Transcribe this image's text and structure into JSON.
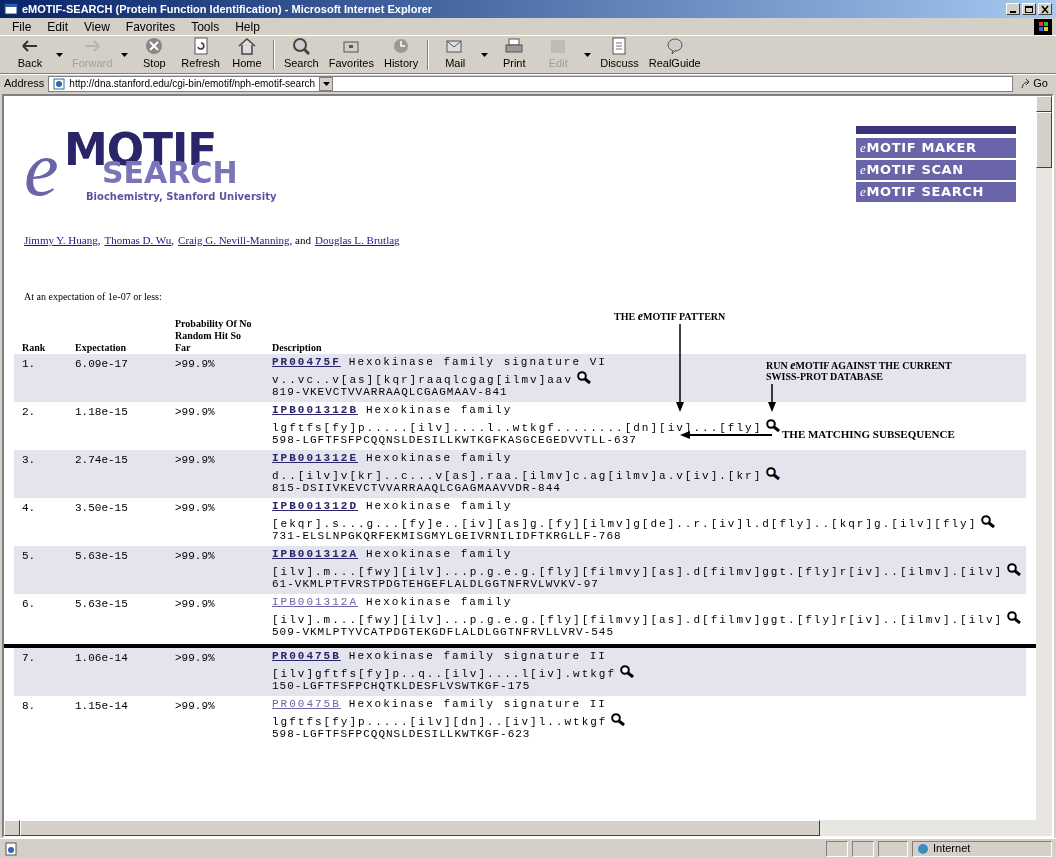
{
  "window": {
    "title": "eMOTIF-SEARCH (Protein Function Identification) - Microsoft Internet Explorer"
  },
  "menu": [
    "File",
    "Edit",
    "View",
    "Favorites",
    "Tools",
    "Help"
  ],
  "toolbar": [
    {
      "label": "Back",
      "kind": "back",
      "disabled": false,
      "dropdown": true
    },
    {
      "label": "Forward",
      "kind": "forward",
      "disabled": true,
      "dropdown": true
    },
    {
      "label": "Stop",
      "kind": "stop",
      "disabled": false,
      "dropdown": false
    },
    {
      "label": "Refresh",
      "kind": "refresh",
      "disabled": false,
      "dropdown": false
    },
    {
      "label": "Home",
      "kind": "home",
      "disabled": false,
      "dropdown": false
    },
    {
      "label": "Search",
      "kind": "search",
      "disabled": false,
      "dropdown": false
    },
    {
      "label": "Favorites",
      "kind": "favorites",
      "disabled": false,
      "dropdown": false
    },
    {
      "label": "History",
      "kind": "history",
      "disabled": false,
      "dropdown": false
    },
    {
      "label": "Mail",
      "kind": "mail",
      "disabled": false,
      "dropdown": true
    },
    {
      "label": "Print",
      "kind": "print",
      "disabled": false,
      "dropdown": false
    },
    {
      "label": "Edit",
      "kind": "edit",
      "disabled": true,
      "dropdown": true
    },
    {
      "label": "Discuss",
      "kind": "discuss",
      "disabled": false,
      "dropdown": false
    },
    {
      "label": "RealGuide",
      "kind": "realguide",
      "disabled": false,
      "dropdown": false
    }
  ],
  "address": {
    "label": "Address",
    "value": "http://dna.stanford.edu/cgi-bin/emotif/nph-emotif-search",
    "go": "Go"
  },
  "logo": {
    "e": "e",
    "motif": "MOTIF",
    "search": "SEARCH",
    "subtitle": "Biochemistry, Stanford University"
  },
  "nav": [
    {
      "prefix": "e",
      "label": "MOTIF MAKER"
    },
    {
      "prefix": "e",
      "label": "MOTIF SCAN"
    },
    {
      "prefix": "e",
      "label": "MOTIF SEARCH"
    }
  ],
  "authors": [
    {
      "name": "Jimmy Y. Huang",
      "sep": ","
    },
    {
      "name": "Thomas D. Wu",
      "sep": ","
    },
    {
      "name": "Craig G. Nevill-Manning",
      "sep": ", and"
    },
    {
      "name": "Douglas L. Brutlag"
    }
  ],
  "intro": "At an expectation of 1e-07 or less:",
  "columns": [
    "Rank",
    "Expectation",
    "Probability Of No Random Hit So Far",
    "Description"
  ],
  "rows": [
    {
      "rank": "1.",
      "expectation": "6.09e-17",
      "probability": ">99.9%",
      "id": "PR00475F",
      "visited": false,
      "title": "Hexokinase family signature VI",
      "pattern": "v..vc..v[as][kqr]raaqlcgag[ilmv]aav",
      "subsequence": "819-VKEVCTVVARRAAQLCGAGMAAV-841",
      "divider_before": false
    },
    {
      "rank": "2.",
      "expectation": "1.18e-15",
      "probability": ">99.9%",
      "id": "IPB001312B",
      "visited": false,
      "title": "Hexokinase family",
      "pattern": "lgftfs[fy]p.....[ilv]....l..wtkgf........[dn][iv]...[fly]",
      "subsequence": "598-LGFTFSFPCQQNSLDESILLKWTKGFKASGCEGEDVVTLL-637",
      "divider_before": false
    },
    {
      "rank": "3.",
      "expectation": "2.74e-15",
      "probability": ">99.9%",
      "id": "IPB001312E",
      "visited": false,
      "title": "Hexokinase family",
      "pattern": "d..[ilv]v[kr]..c...v[as].raa.[ilmv]c.ag[ilmv]a.v[iv].[kr]",
      "subsequence": "815-DSIIVKEVCTVVARRAAQLCGAGMAAVVDR-844",
      "divider_before": false
    },
    {
      "rank": "4.",
      "expectation": "3.50e-15",
      "probability": ">99.9%",
      "id": "IPB001312D",
      "visited": false,
      "title": "Hexokinase family",
      "pattern": "[ekqr].s...g...[fy]e..[iv][as]g.[fy][ilmv]g[de]..r.[iv]l.d[fly]..[kqr]g.[ilv][fly]",
      "subsequence": "731-ELSLNPGKQRFEKMISGMYLGEIVRNILIDFTKRGLLF-768",
      "divider_before": false
    },
    {
      "rank": "5.",
      "expectation": "5.63e-15",
      "probability": ">99.9%",
      "id": "IPB001312A",
      "visited": false,
      "title": "Hexokinase family",
      "pattern": "[ilv].m...[fwy][ilv]...p.g.e.g.[fly][filmvy][as].d[filmv]ggt.[fly]r[iv]..[ilmv].[ilv]",
      "subsequence": "61-VKMLPTFVRSTPDGTEHGEFLALDLGGTNFRVLWVKV-97",
      "divider_before": false
    },
    {
      "rank": "6.",
      "expectation": "5.63e-15",
      "probability": ">99.9%",
      "id": "IPB001312A",
      "visited": true,
      "title": "Hexokinase family",
      "pattern": "[ilv].m...[fwy][ilv]...p.g.e.g.[fly][filmvy][as].d[filmv]ggt.[fly]r[iv]..[ilmv].[ilv]",
      "subsequence": "509-VKMLPTYVCATPDGTEKGDFLALDLGGTNFRVLLVRV-545",
      "divider_before": false
    },
    {
      "rank": "7.",
      "expectation": "1.06e-14",
      "probability": ">99.9%",
      "id": "PR00475B",
      "visited": false,
      "title": "Hexokinase family signature II",
      "pattern": "[ilv]gftfs[fy]p..q..[ilv]....l[iv].wtkgf",
      "subsequence": "150-LGFTFSFPCHQTKLDESFLVSWTKGF-175",
      "divider_before": true
    },
    {
      "rank": "8.",
      "expectation": "1.15e-14",
      "probability": ">99.9%",
      "id": "PR00475B",
      "visited": true,
      "title": "Hexokinase family signature II",
      "pattern": "lgftfs[fy]p.....[ilv][dn]..[iv]l..wtkgf",
      "subsequence": "598-LGFTFSFPCQQNSLDESILLKWTKGF-623",
      "divider_before": false
    }
  ],
  "annotations": {
    "pattern": {
      "before": "THE ",
      "prefix": "e",
      "after": "MOTIF PATTERN"
    },
    "run": {
      "before": "RUN ",
      "prefix": "e",
      "after": "MOTIF AGAINST THE CURRENT SWISS-PROT DATABASE"
    },
    "match": "THE MATCHING SUBSEQUENCE"
  },
  "status_bar": {
    "zone": "Internet"
  }
}
